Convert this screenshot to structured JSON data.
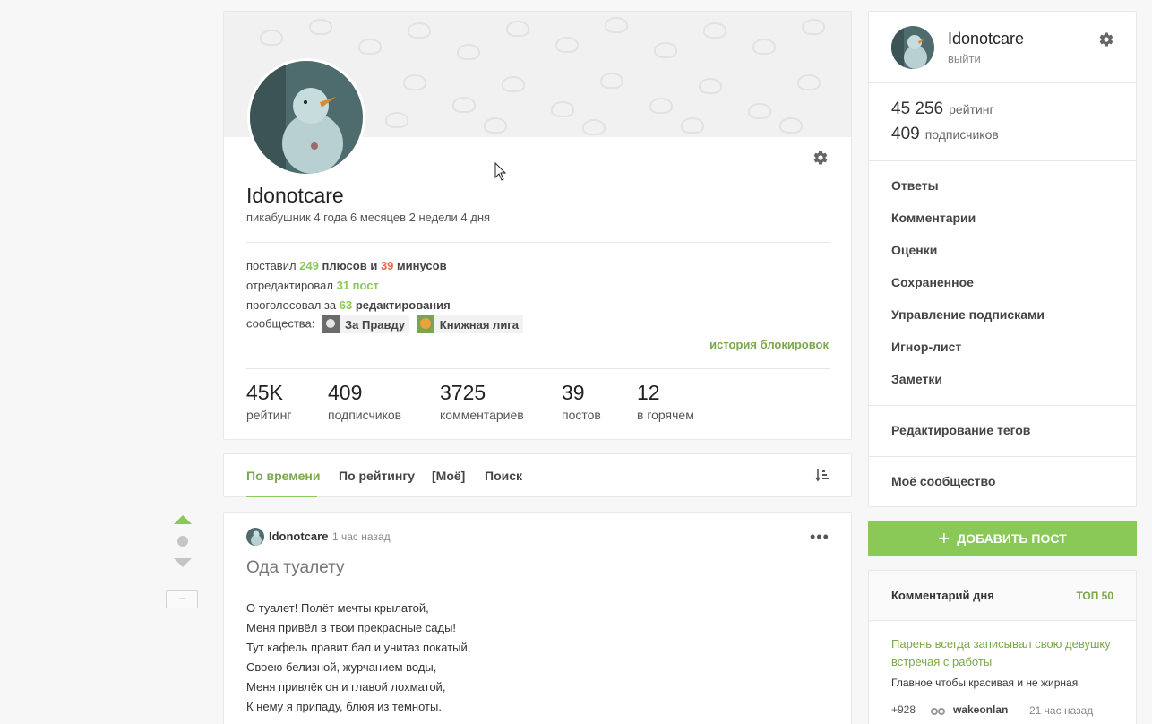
{
  "profile": {
    "username": "Idonotcare",
    "member_since": "пикабушник 4 года 6 месяцев 2 недели 4 дня",
    "activity": {
      "line1_prefix": "поставил",
      "pluses": "249",
      "line1_mid": "плюсов и",
      "minuses": "39",
      "line1_suffix": "минусов",
      "line2_prefix": "отредактировал",
      "edited": "31 пост",
      "line3_prefix": "проголосовал за",
      "voted": "63",
      "line3_suffix": "редактирования",
      "communities_label": "сообщества:",
      "communities": [
        "За Правду",
        "Книжная лига"
      ]
    },
    "ban_history": "история блокировок",
    "stats": [
      {
        "value": "45K",
        "label": "рейтинг"
      },
      {
        "value": "409",
        "label": "подписчиков"
      },
      {
        "value": "3725",
        "label": "комментариев"
      },
      {
        "value": "39",
        "label": "постов"
      },
      {
        "value": "12",
        "label": "в горячем"
      }
    ]
  },
  "tabs": [
    "По времени",
    "По рейтингу",
    "[Моё]",
    "Поиск"
  ],
  "post": {
    "author": "Idonotcare",
    "time": "1 час назад",
    "title": "Ода туалету",
    "lines": [
      "О туалет! Полёт мечты крылатой,",
      "Меня привёл в твои прекрасные сады!",
      "Тут кафель правит бал и унитаз покатый,",
      "Своею белизной, журчанием воды,",
      "Меня привлёк он и главой лохматой,",
      "К нему я припаду, блюя из темноты."
    ],
    "collapse_label": "–"
  },
  "sidebar": {
    "username": "Idonotcare",
    "logout": "выйти",
    "rating_value": "45 256",
    "rating_label": "рейтинг",
    "subs_value": "409",
    "subs_label": "подписчиков",
    "menu": [
      "Ответы",
      "Комментарии",
      "Оценки",
      "Сохраненное",
      "Управление подписками",
      "Игнор-лист",
      "Заметки"
    ],
    "tags_edit": "Редактирование тегов",
    "my_community": "Моё сообщество"
  },
  "add_post": {
    "plus": "+",
    "label": "ДОБАВИТЬ ПОСТ"
  },
  "comment_of_day": {
    "title": "Комментарий дня",
    "top": "ТОП 50",
    "post_title": "Парень всегда записывал свою девушку встречая с работы",
    "text": "Главное чтобы красивая и не жирная",
    "rating": "+928",
    "user": "wakeonlan",
    "time": "21 час назад"
  },
  "colors": {
    "accent": "#8ac858",
    "accent_text": "#7ba84b",
    "minus": "#e86742"
  }
}
